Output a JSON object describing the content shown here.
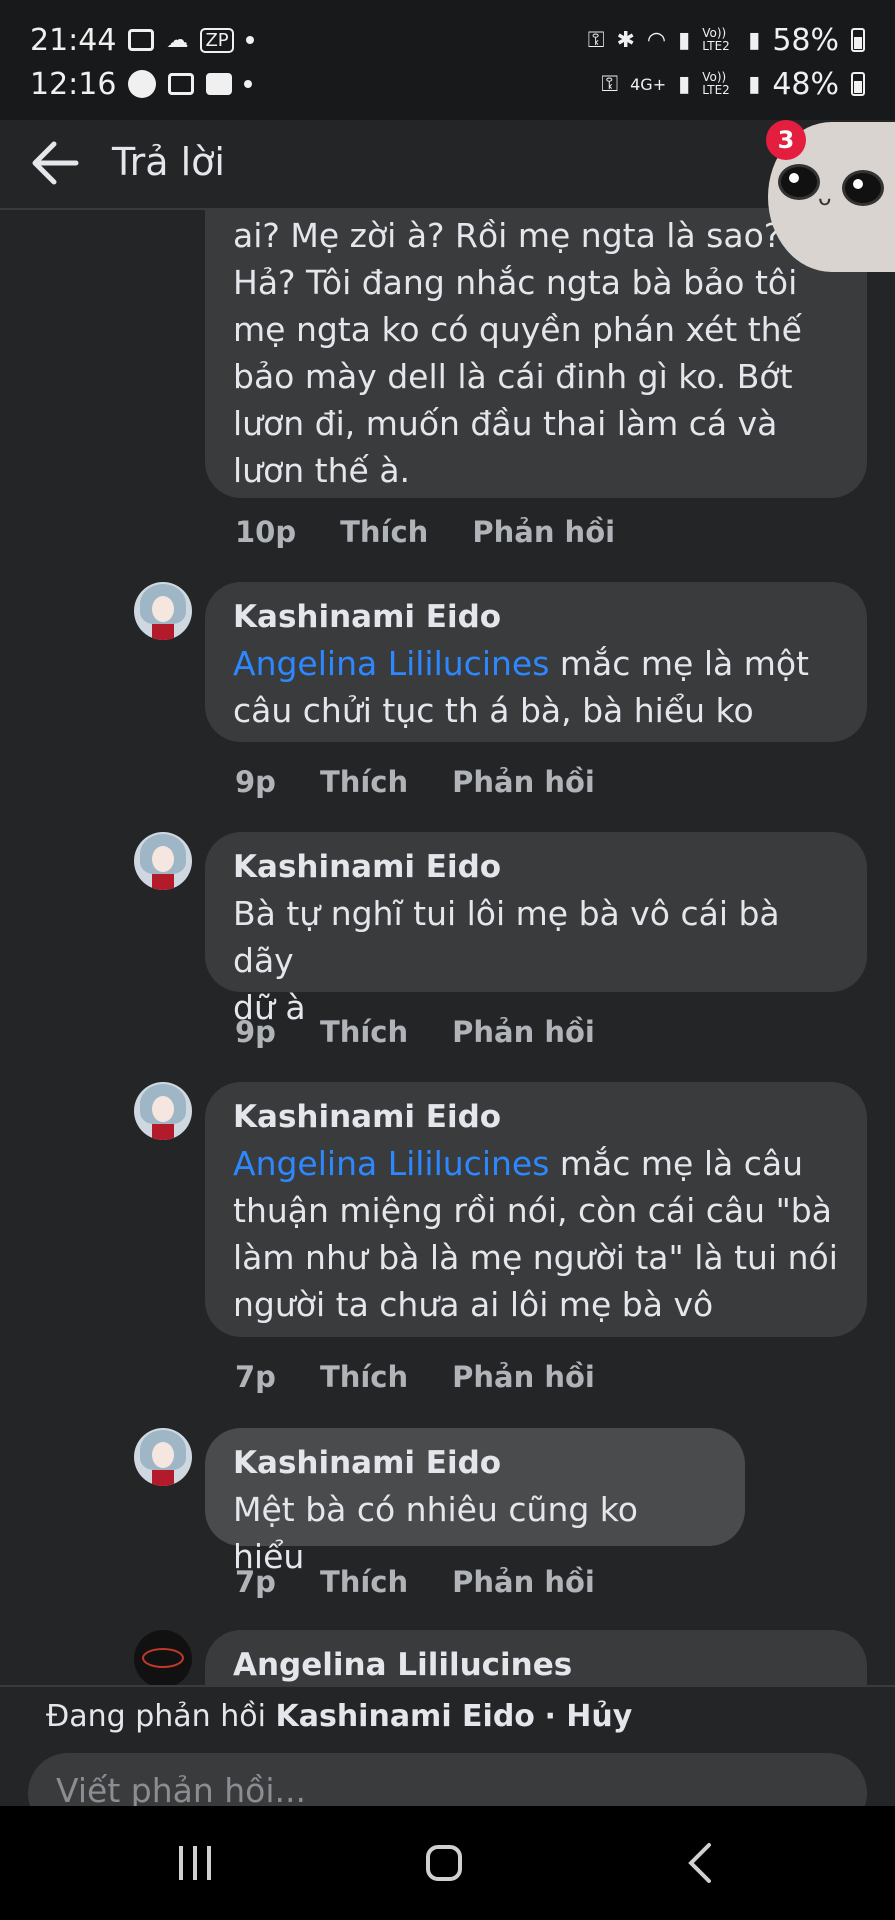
{
  "status": {
    "row1": {
      "time": "21:44",
      "tag": "ZP",
      "battery": "58%"
    },
    "row2": {
      "time": "12:16",
      "network": "4G+",
      "battery": "48%"
    },
    "volte": "Vo)) LTE2"
  },
  "header": {
    "title": "Trả lời",
    "badge": "3"
  },
  "comments": [
    {
      "author": "",
      "lines": [
        "ai? Mẹ zời à? Rồi mẹ ngta là sao?",
        "Hả? Tôi đang nhắc ngta bà bảo tôi",
        "mẹ ngta ko có quyền phán xét thế",
        "bảo mày dell là cái đinh gì ko. Bớt",
        "lươn đi, muốn đầu thai làm cá và",
        "lươn thế à."
      ],
      "time": "10p"
    },
    {
      "author": "Kashinami Eido",
      "mention": "Angelina Lililucines",
      "lines": [
        " mắc mẹ là một",
        "câu chửi tục th á bà, bà hiểu ko"
      ],
      "time": "9p"
    },
    {
      "author": "Kashinami Eido",
      "lines": [
        "Bà tự nghĩ tui lôi mẹ bà vô cái bà dãy",
        "dữ à"
      ],
      "time": "9p"
    },
    {
      "author": "Kashinami Eido",
      "mention": "Angelina Lililucines",
      "lines": [
        " mắc mẹ là câu",
        "thuận miệng rồi nói, còn cái câu \"bà",
        "làm như bà là mẹ người ta\" là tui nói",
        "người ta chưa ai lôi mẹ bà vô"
      ],
      "time": "7p"
    },
    {
      "author": "Kashinami Eido",
      "lines": [
        "Mệt bà có nhiêu cũng ko hiểu"
      ],
      "time": "7p"
    },
    {
      "author": "Angelina Lililucines"
    }
  ],
  "actions": {
    "like": "Thích",
    "reply": "Phản hồi"
  },
  "reply_bar": {
    "prefix": "Đang phản hồi",
    "target": "Kashinami Eido",
    "cancel": "· Hủy",
    "placeholder": "Viết phản hồi..."
  }
}
